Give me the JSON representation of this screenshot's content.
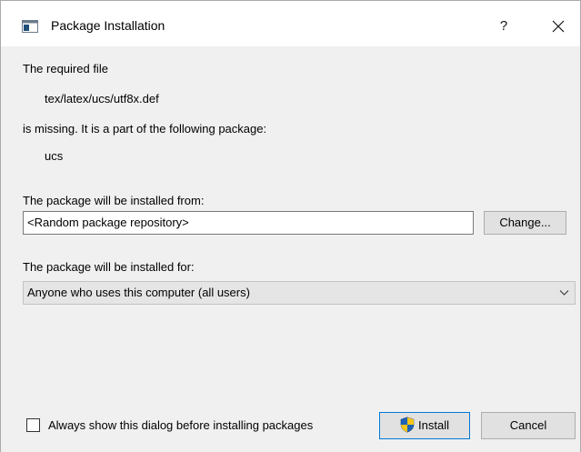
{
  "window": {
    "title": "Package Installation",
    "help_label": "?"
  },
  "message": {
    "required_file_label": "The required file",
    "file_path": "tex/latex/ucs/utf8x.def",
    "missing_text": "is missing. It is a part of the following package:",
    "package_name": "ucs"
  },
  "source": {
    "label": "The package will be installed from:",
    "value": "<Random package repository>",
    "change_label": "Change..."
  },
  "target": {
    "label": "The package will be installed for:",
    "selected": "Anyone who uses this computer (all users)"
  },
  "footer": {
    "always_show_label": "Always show this dialog before installing packages",
    "always_show_checked": false,
    "install_label": "Install",
    "cancel_label": "Cancel"
  },
  "colors": {
    "accent": "#0078d7",
    "content_bg": "#f0f0f0",
    "button_bg": "#e1e1e1"
  },
  "icons": {
    "app": "window-icon",
    "close": "close-icon",
    "dropdown": "chevron-down-icon",
    "install": "uac-shield-icon"
  }
}
